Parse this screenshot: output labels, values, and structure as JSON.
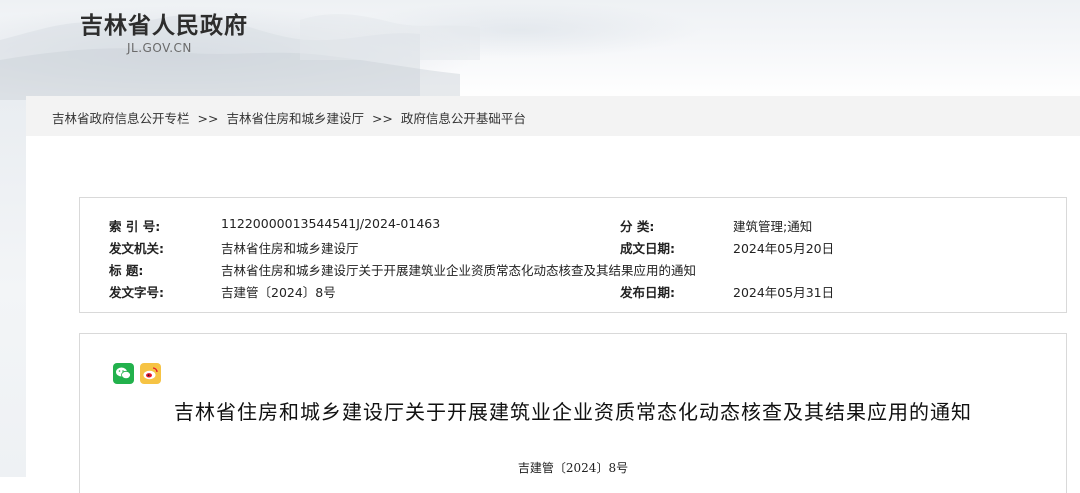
{
  "site": {
    "title": "吉林省人民政府",
    "domain": "JL.GOV.CN"
  },
  "breadcrumb": {
    "items": [
      "吉林省政府信息公开专栏",
      "吉林省住房和城乡建设厅",
      "政府信息公开基础平台"
    ],
    "separator": ">>"
  },
  "info": {
    "index_label": "索 引 号:",
    "index_value": "11220000013544541J/2024-01463",
    "category_label": "分 类:",
    "category_value": "建筑管理;通知",
    "issuer_label": "发文机关:",
    "issuer_value": "吉林省住房和城乡建设厅",
    "created_label": "成文日期:",
    "created_value": "2024年05月20日",
    "title_label": "标 题:",
    "title_value": "吉林省住房和城乡建设厅关于开展建筑业企业资质常态化动态核查及其结果应用的通知",
    "docno_label": "发文字号:",
    "docno_value": "吉建管〔2024〕8号",
    "published_label": "发布日期:",
    "published_value": "2024年05月31日"
  },
  "article": {
    "share_icons": [
      "wechat-icon",
      "weibo-icon"
    ],
    "title": "吉林省住房和城乡建设厅关于开展建筑业企业资质常态化动态核查及其结果应用的通知",
    "doc_number": "吉建管〔2024〕8号"
  },
  "colors": {
    "wechat": "#22b14c",
    "weibo": "#f6c344",
    "border": "#d9d9d9",
    "breadcrumb_bg": "#f3f3f3"
  }
}
